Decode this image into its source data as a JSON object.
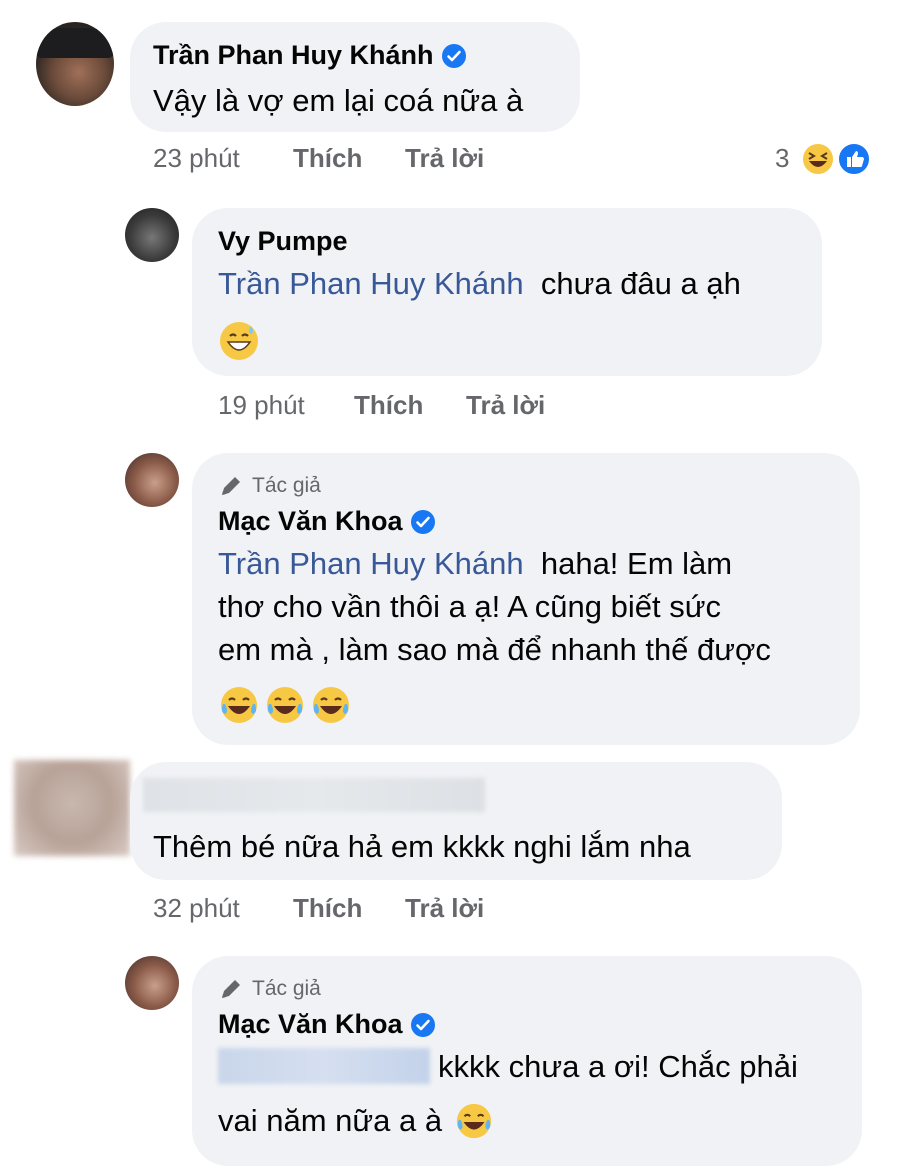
{
  "comments": [
    {
      "author": "Trần Phan Huy Khánh",
      "verified": true,
      "text": "Vậy là vợ em lại coá nữa à",
      "time": "23 phút",
      "like_label": "Thích",
      "reply_label": "Trả lời",
      "reaction_count": "3",
      "reactions": [
        "haha-emoji",
        "like-emoji"
      ]
    },
    {
      "author": "Vy Pumpe",
      "mention": "Trần Phan Huy Khánh",
      "text": "chưa đâu a ạh",
      "emoji": "grinning-sweat-emoji",
      "time": "19 phút",
      "like_label": "Thích",
      "reply_label": "Trả lời"
    },
    {
      "badge": "Tác giả",
      "author": "Mạc Văn Khoa",
      "verified": true,
      "mention": "Trần Phan Huy Khánh",
      "text_line1": "haha! Em làm",
      "text_line2": "thơ cho vần thôi a ạ! A cũng biết sức",
      "text_line3": "em mà , làm sao mà để nhanh thế được",
      "emojis": [
        "tears-of-joy-emoji",
        "tears-of-joy-emoji",
        "tears-of-joy-emoji"
      ]
    },
    {
      "text": "Thêm bé nữa hả em kkkk nghi lắm nha",
      "time": "32 phút",
      "like_label": "Thích",
      "reply_label": "Trả lời"
    },
    {
      "badge": "Tác giả",
      "author": "Mạc Văn Khoa",
      "verified": true,
      "text_line1": "kkkk chưa a ơi! Chắc phải",
      "text_line2": "vai năm nữa a à",
      "emoji": "tears-of-joy-emoji"
    }
  ],
  "colors": {
    "bubble": "#f0f2f5",
    "mention": "#385898",
    "meta": "#65676b",
    "verified": "#1877f2"
  }
}
